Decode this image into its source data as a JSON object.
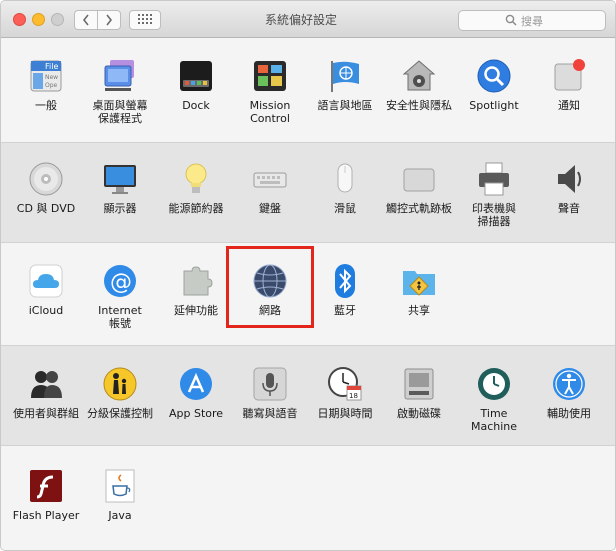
{
  "window": {
    "title": "系統偏好設定",
    "search_placeholder": "搜尋"
  },
  "toolbar": {
    "back_icon": "chevron-left-icon",
    "forward_icon": "chevron-right-icon",
    "show_all_icon": "grid-icon"
  },
  "rows": [
    {
      "items": [
        {
          "label": "一般",
          "icon": "general-icon"
        },
        {
          "label": "桌面與螢幕\n保護程式",
          "icon": "desktop-icon"
        },
        {
          "label": "Dock",
          "icon": "dock-icon"
        },
        {
          "label": "Mission\nControl",
          "icon": "mission-control-icon"
        },
        {
          "label": "語言與地區",
          "icon": "language-flag-icon"
        },
        {
          "label": "安全性與隱私",
          "icon": "security-house-icon"
        },
        {
          "label": "Spotlight",
          "icon": "spotlight-icon"
        },
        {
          "label": "通知",
          "icon": "notifications-icon"
        }
      ]
    },
    {
      "items": [
        {
          "label": "CD 與 DVD",
          "icon": "cd-dvd-icon"
        },
        {
          "label": "顯示器",
          "icon": "display-icon"
        },
        {
          "label": "能源節約器",
          "icon": "lightbulb-icon"
        },
        {
          "label": "鍵盤",
          "icon": "keyboard-icon"
        },
        {
          "label": "滑鼠",
          "icon": "mouse-icon"
        },
        {
          "label": "觸控式軌跡板",
          "icon": "trackpad-icon"
        },
        {
          "label": "印表機與\n掃描器",
          "icon": "printer-icon"
        },
        {
          "label": "聲音",
          "icon": "speaker-icon"
        }
      ]
    },
    {
      "items": [
        {
          "label": "iCloud",
          "icon": "icloud-icon"
        },
        {
          "label": "Internet\n帳號",
          "icon": "at-sign-icon"
        },
        {
          "label": "延伸功能",
          "icon": "puzzle-icon"
        },
        {
          "label": "網路",
          "icon": "network-globe-icon"
        },
        {
          "label": "藍牙",
          "icon": "bluetooth-icon"
        },
        {
          "label": "共享",
          "icon": "sharing-folder-icon"
        }
      ]
    },
    {
      "items": [
        {
          "label": "使用者與群組",
          "icon": "users-icon"
        },
        {
          "label": "分級保護控制",
          "icon": "parental-controls-icon"
        },
        {
          "label": "App Store",
          "icon": "app-store-icon"
        },
        {
          "label": "聽寫與語音",
          "icon": "microphone-icon"
        },
        {
          "label": "日期與時間",
          "icon": "clock-calendar-icon"
        },
        {
          "label": "啟動磁碟",
          "icon": "hard-drive-icon"
        },
        {
          "label": "Time Machine",
          "icon": "time-machine-icon"
        },
        {
          "label": "輔助使用",
          "icon": "accessibility-icon"
        }
      ]
    },
    {
      "items": [
        {
          "label": "Flash Player",
          "icon": "flash-icon"
        },
        {
          "label": "Java",
          "icon": "java-icon"
        }
      ]
    }
  ],
  "colors": {
    "highlight": "#e3261b"
  }
}
